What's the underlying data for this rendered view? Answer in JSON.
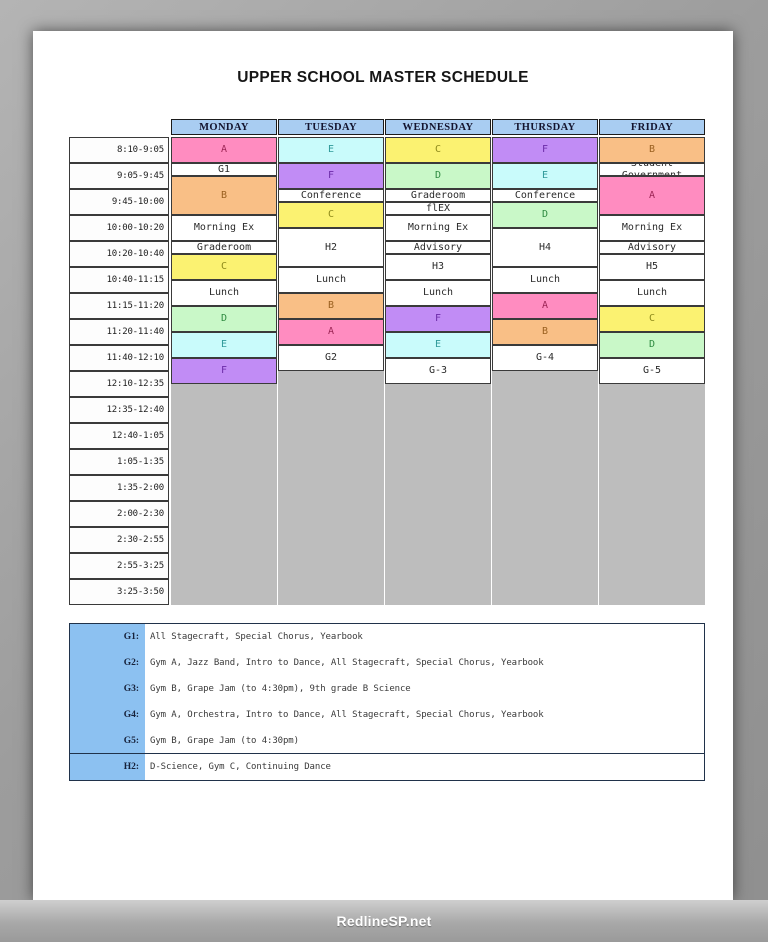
{
  "page": {
    "title": "UPPER SCHOOL MASTER SCHEDULE",
    "footer_watermark": "RedlineSP.net"
  },
  "schedule": {
    "day_headers": [
      "MONDAY",
      "TUESDAY",
      "WEDNESDAY",
      "THURSDAY",
      "FRIDAY"
    ],
    "time_slots": [
      "8:10-9:05",
      "9:05-9:45",
      "9:45-10:00",
      "10:00-10:20",
      "10:20-10:40",
      "10:40-11:15",
      "11:15-11:20",
      "11:20-11:40",
      "11:40-12:10",
      "12:10-12:35",
      "12:35-12:40",
      "12:40-1:05",
      "1:05-1:35",
      "1:35-2:00",
      "2:00-2:30",
      "2:30-2:55",
      "2:55-3:25",
      "3:25-3:50"
    ],
    "colors": {
      "header_blue": "#A9CDF2",
      "block_a_pink": "#FF8CC0",
      "block_b_orange": "#F9BF86",
      "block_c_yellow": "#FBF271",
      "block_d_green": "#C9F8C8",
      "block_e_cyan": "#C9FBFB",
      "block_f_purple": "#C18CF5",
      "plain_white": "#FFFFFF",
      "legend_blue": "#8CC1F1"
    },
    "columns": [
      {
        "day": "MONDAY",
        "cells": [
          {
            "label": "A",
            "color": "pink",
            "start": 0,
            "span": 2
          },
          {
            "label": "G1",
            "color": "white",
            "start": 2,
            "span": 1
          },
          {
            "label": "B",
            "color": "orange",
            "start": 3,
            "span": 3
          },
          {
            "label": "Morning Ex",
            "color": "white",
            "start": 6,
            "span": 2
          },
          {
            "label": "Graderoom",
            "color": "white",
            "start": 8,
            "span": 1
          },
          {
            "label": "C",
            "color": "yellow",
            "start": 9,
            "span": 2
          },
          {
            "label": "Lunch",
            "color": "white",
            "start": 11,
            "span": 2
          },
          {
            "label": "D",
            "color": "green",
            "start": 13,
            "span": 2
          },
          {
            "label": "E",
            "color": "cyan",
            "start": 15,
            "span": 2
          },
          {
            "label": "F",
            "color": "purple",
            "start": 17,
            "span": 2
          }
        ]
      },
      {
        "day": "TUESDAY",
        "cells": [
          {
            "label": "E",
            "color": "cyan",
            "start": 0,
            "span": 2
          },
          {
            "label": "F",
            "color": "purple",
            "start": 2,
            "span": 2
          },
          {
            "label": "Conference",
            "color": "white",
            "start": 4,
            "span": 1
          },
          {
            "label": "C",
            "color": "yellow",
            "start": 5,
            "span": 2
          },
          {
            "label": "H2",
            "color": "white",
            "start": 7,
            "span": 3
          },
          {
            "label": "Lunch",
            "color": "white",
            "start": 10,
            "span": 2
          },
          {
            "label": "B",
            "color": "orange",
            "start": 12,
            "span": 2
          },
          {
            "label": "A",
            "color": "pink",
            "start": 14,
            "span": 2
          },
          {
            "label": "G2",
            "color": "white",
            "start": 16,
            "span": 2
          }
        ]
      },
      {
        "day": "WEDNESDAY",
        "cells": [
          {
            "label": "C",
            "color": "yellow",
            "start": 0,
            "span": 2
          },
          {
            "label": "D",
            "color": "green",
            "start": 2,
            "span": 2
          },
          {
            "label": "Graderoom",
            "color": "white",
            "start": 4,
            "span": 1
          },
          {
            "label": "flEX",
            "color": "white",
            "start": 5,
            "span": 1
          },
          {
            "label": "Morning Ex",
            "color": "white",
            "start": 6,
            "span": 2
          },
          {
            "label": "Advisory",
            "color": "white",
            "start": 8,
            "span": 1
          },
          {
            "label": "H3",
            "color": "white",
            "start": 9,
            "span": 2
          },
          {
            "label": "Lunch",
            "color": "white",
            "start": 11,
            "span": 2
          },
          {
            "label": "F",
            "color": "purple",
            "start": 13,
            "span": 2
          },
          {
            "label": "E",
            "color": "cyan",
            "start": 15,
            "span": 2
          },
          {
            "label": "G-3",
            "color": "white",
            "start": 17,
            "span": 2
          }
        ]
      },
      {
        "day": "THURSDAY",
        "cells": [
          {
            "label": "F",
            "color": "purple",
            "start": 0,
            "span": 2
          },
          {
            "label": "E",
            "color": "cyan",
            "start": 2,
            "span": 2
          },
          {
            "label": "Conference",
            "color": "white",
            "start": 4,
            "span": 1
          },
          {
            "label": "D",
            "color": "green",
            "start": 5,
            "span": 2
          },
          {
            "label": "H4",
            "color": "white",
            "start": 7,
            "span": 3
          },
          {
            "label": "Lunch",
            "color": "white",
            "start": 10,
            "span": 2
          },
          {
            "label": "A",
            "color": "pink",
            "start": 12,
            "span": 2
          },
          {
            "label": "B",
            "color": "orange",
            "start": 14,
            "span": 2
          },
          {
            "label": "G-4",
            "color": "white",
            "start": 16,
            "span": 2
          }
        ]
      },
      {
        "day": "FRIDAY",
        "cells": [
          {
            "label": "B",
            "color": "orange",
            "start": 0,
            "span": 2
          },
          {
            "label": "Student\nGovernment",
            "color": "white",
            "start": 2,
            "span": 1
          },
          {
            "label": "A",
            "color": "pink",
            "start": 3,
            "span": 3
          },
          {
            "label": "Morning Ex",
            "color": "white",
            "start": 6,
            "span": 2
          },
          {
            "label": "Advisory",
            "color": "white",
            "start": 8,
            "span": 1
          },
          {
            "label": "H5",
            "color": "white",
            "start": 9,
            "span": 2
          },
          {
            "label": "Lunch",
            "color": "white",
            "start": 11,
            "span": 2
          },
          {
            "label": "C",
            "color": "yellow",
            "start": 13,
            "span": 2
          },
          {
            "label": "D",
            "color": "green",
            "start": 15,
            "span": 2
          },
          {
            "label": "G-5",
            "color": "white",
            "start": 17,
            "span": 2
          }
        ]
      }
    ]
  },
  "legend": {
    "group_g": [
      {
        "key": "G1:",
        "value": "All Stagecraft, Special Chorus, Yearbook"
      },
      {
        "key": "G2:",
        "value": "Gym A, Jazz Band, Intro to Dance, All Stagecraft, Special Chorus, Yearbook"
      },
      {
        "key": "G3:",
        "value": "Gym B, Grape Jam (to 4:30pm), 9th grade B Science"
      },
      {
        "key": "G4:",
        "value": "Gym A, Orchestra, Intro to Dance, All Stagecraft, Special Chorus, Yearbook"
      },
      {
        "key": "G5:",
        "value": "Gym B, Grape Jam (to 4:30pm)"
      }
    ],
    "group_h": [
      {
        "key": "H2:",
        "value": "D-Science, Gym C, Continuing Dance"
      }
    ]
  }
}
